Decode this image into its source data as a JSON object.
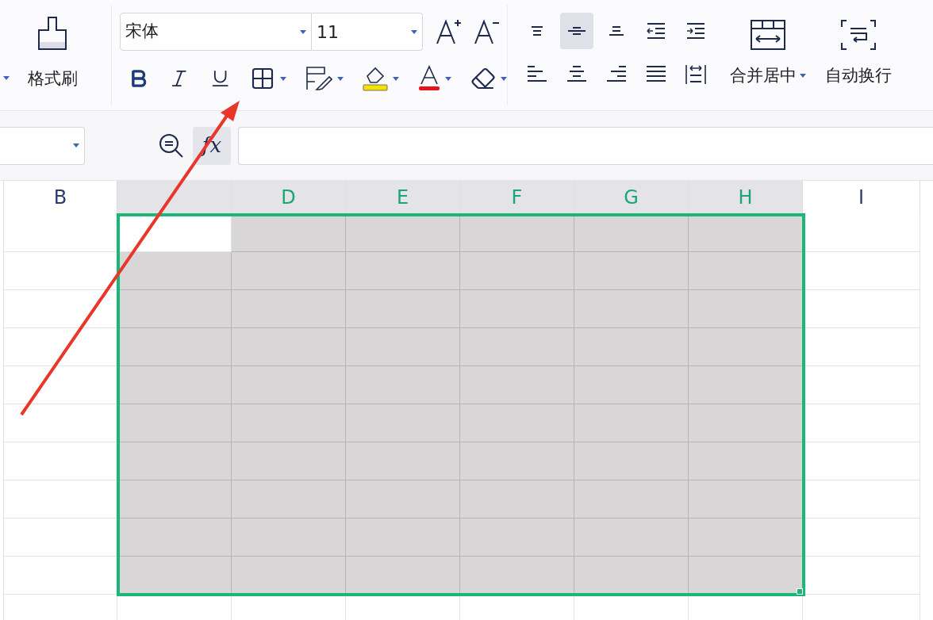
{
  "toolbar": {
    "format_painter": {
      "label": "格式刷"
    },
    "font": {
      "name": "宋体",
      "size": "11"
    },
    "align_buttons": [
      {
        "kind": "top",
        "selected": false
      },
      {
        "kind": "middle",
        "selected": true
      },
      {
        "kind": "bottom",
        "selected": false
      },
      {
        "kind": "outdent",
        "selected": false
      },
      {
        "kind": "indent",
        "selected": false
      },
      {
        "kind": "left",
        "selected": false
      },
      {
        "kind": "center",
        "selected": false
      },
      {
        "kind": "right",
        "selected": false
      },
      {
        "kind": "justify",
        "selected": false
      },
      {
        "kind": "distribute",
        "selected": false
      }
    ],
    "merge": {
      "label": "合并居中"
    },
    "wrap": {
      "label": "自动换行"
    }
  },
  "formula_bar": {
    "fx_label": "fx"
  },
  "sheet": {
    "columns": [
      {
        "label": "B",
        "selected": false
      },
      {
        "selected": true
      },
      {
        "label": "D",
        "selected": true
      },
      {
        "label": "E",
        "selected": true
      },
      {
        "label": "F",
        "selected": true
      },
      {
        "label": "G",
        "selected": true
      },
      {
        "label": "H",
        "selected": true
      },
      {
        "label": "I",
        "selected": false
      }
    ],
    "rows": [
      {
        "cells": [
          {
            "selected": false
          },
          {
            "selected": false
          },
          {
            "selected": true
          },
          {
            "selected": true
          },
          {
            "selected": true
          },
          {
            "selected": true
          },
          {
            "selected": true
          },
          {
            "selected": false
          }
        ]
      },
      {
        "cells": [
          {
            "selected": false
          },
          {
            "selected": true
          },
          {
            "selected": true
          },
          {
            "selected": true
          },
          {
            "selected": true
          },
          {
            "selected": true
          },
          {
            "selected": true
          },
          {
            "selected": false
          }
        ]
      },
      {
        "cells": [
          {
            "selected": false
          },
          {
            "selected": true
          },
          {
            "selected": true
          },
          {
            "selected": true
          },
          {
            "selected": true
          },
          {
            "selected": true
          },
          {
            "selected": true
          },
          {
            "selected": false
          }
        ]
      },
      {
        "cells": [
          {
            "selected": false
          },
          {
            "selected": true
          },
          {
            "selected": true
          },
          {
            "selected": true
          },
          {
            "selected": true
          },
          {
            "selected": true
          },
          {
            "selected": true
          },
          {
            "selected": false
          }
        ]
      },
      {
        "cells": [
          {
            "selected": false
          },
          {
            "selected": true
          },
          {
            "selected": true
          },
          {
            "selected": true
          },
          {
            "selected": true
          },
          {
            "selected": true
          },
          {
            "selected": true
          },
          {
            "selected": false
          }
        ]
      },
      {
        "cells": [
          {
            "selected": false
          },
          {
            "selected": true
          },
          {
            "selected": true
          },
          {
            "selected": true
          },
          {
            "selected": true
          },
          {
            "selected": true
          },
          {
            "selected": true
          },
          {
            "selected": false
          }
        ]
      },
      {
        "cells": [
          {
            "selected": false
          },
          {
            "selected": true
          },
          {
            "selected": true
          },
          {
            "selected": true
          },
          {
            "selected": true
          },
          {
            "selected": true
          },
          {
            "selected": true
          },
          {
            "selected": false
          }
        ]
      },
      {
        "cells": [
          {
            "selected": false
          },
          {
            "selected": true
          },
          {
            "selected": true
          },
          {
            "selected": true
          },
          {
            "selected": true
          },
          {
            "selected": true
          },
          {
            "selected": true
          },
          {
            "selected": false
          }
        ]
      },
      {
        "cells": [
          {
            "selected": false
          },
          {
            "selected": true
          },
          {
            "selected": true
          },
          {
            "selected": true
          },
          {
            "selected": true
          },
          {
            "selected": true
          },
          {
            "selected": true
          },
          {
            "selected": false
          }
        ]
      },
      {
        "cells": [
          {
            "selected": false
          },
          {
            "selected": true
          },
          {
            "selected": true
          },
          {
            "selected": true
          },
          {
            "selected": true
          },
          {
            "selected": true
          },
          {
            "selected": true
          },
          {
            "selected": false
          }
        ]
      },
      {
        "cells": [
          {
            "selected": false
          },
          {
            "selected": false
          },
          {
            "selected": false
          },
          {
            "selected": false
          },
          {
            "selected": false
          },
          {
            "selected": false
          },
          {
            "selected": false
          },
          {
            "selected": false
          }
        ]
      }
    ]
  }
}
